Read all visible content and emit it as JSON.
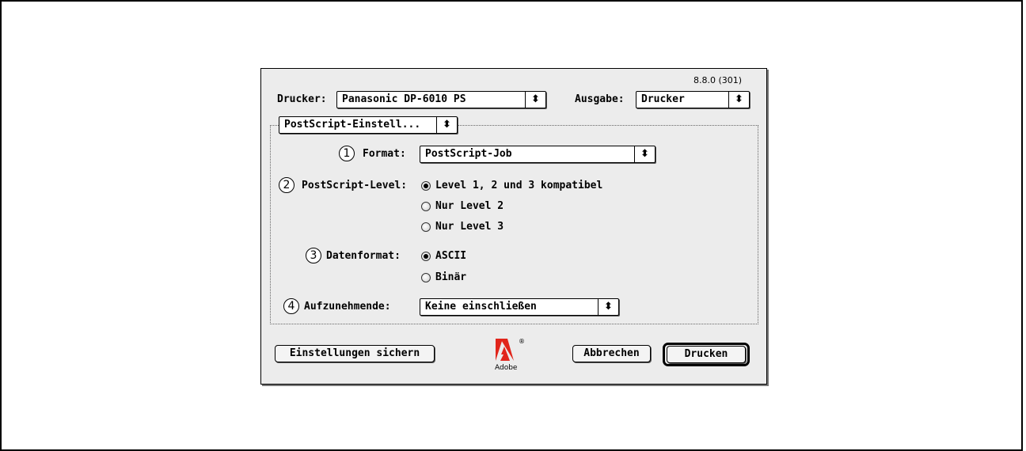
{
  "version": "8.8.0 (301)",
  "printer": {
    "label": "Drucker:",
    "value": "Panasonic DP-6010 PS"
  },
  "output": {
    "label": "Ausgabe:",
    "value": "Drucker"
  },
  "section_popup": {
    "value": "PostScript-Einstell..."
  },
  "format": {
    "number": "1",
    "label": "Format:",
    "value": "PostScript-Job"
  },
  "postscript_level": {
    "number": "2",
    "label": "PostScript-Level:",
    "options": [
      "Level 1, 2 und 3 kompatibel",
      "Nur Level 2",
      "Nur Level 3"
    ],
    "selected_index": 0
  },
  "data_format": {
    "number": "3",
    "label": "Datenformat:",
    "options": [
      "ASCII",
      "Binär"
    ],
    "selected_index": 0
  },
  "include": {
    "number": "4",
    "label": "Aufzunehmende:",
    "value": "Keine einschließen"
  },
  "buttons": {
    "save_settings": "Einstellungen sichern",
    "cancel": "Abbrechen",
    "print": "Drucken"
  },
  "logo": {
    "text": "Adobe",
    "registered": "®"
  },
  "icons": {
    "popup_arrow": "up-down-arrows-icon"
  },
  "colors": {
    "dialog_bg": "#ececec",
    "logo_red": "#e1251b"
  }
}
